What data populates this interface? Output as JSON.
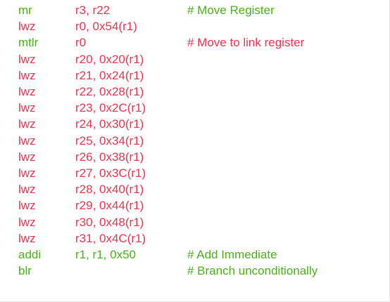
{
  "colors": {
    "green": "#4caf1e",
    "red": "#e8364f"
  },
  "lines": [
    {
      "op": "mr",
      "op_color": "green",
      "args": "r3, r22",
      "args_color": "red",
      "comment": "# Move Register",
      "comment_color": "green"
    },
    {
      "op": "lwz",
      "op_color": "red",
      "args": "r0, 0x54(r1)",
      "args_color": "red",
      "comment": "",
      "comment_color": "red"
    },
    {
      "op": "mtlr",
      "op_color": "green",
      "args": "r0",
      "args_color": "red",
      "comment": "# Move to link register",
      "comment_color": "red"
    },
    {
      "op": "lwz",
      "op_color": "red",
      "args": "r20, 0x20(r1)",
      "args_color": "red",
      "comment": "",
      "comment_color": "red"
    },
    {
      "op": "lwz",
      "op_color": "red",
      "args": "r21, 0x24(r1)",
      "args_color": "red",
      "comment": "",
      "comment_color": "red"
    },
    {
      "op": "lwz",
      "op_color": "red",
      "args": "r22, 0x28(r1)",
      "args_color": "red",
      "comment": "",
      "comment_color": "red"
    },
    {
      "op": "lwz",
      "op_color": "red",
      "args": "r23, 0x2C(r1)",
      "args_color": "red",
      "comment": "",
      "comment_color": "red"
    },
    {
      "op": "lwz",
      "op_color": "red",
      "args": "r24, 0x30(r1)",
      "args_color": "red",
      "comment": "",
      "comment_color": "red"
    },
    {
      "op": "lwz",
      "op_color": "red",
      "args": "r25, 0x34(r1)",
      "args_color": "red",
      "comment": "",
      "comment_color": "red"
    },
    {
      "op": "lwz",
      "op_color": "red",
      "args": "r26, 0x38(r1)",
      "args_color": "red",
      "comment": "",
      "comment_color": "red"
    },
    {
      "op": "lwz",
      "op_color": "red",
      "args": "r27, 0x3C(r1)",
      "args_color": "red",
      "comment": "",
      "comment_color": "red"
    },
    {
      "op": "lwz",
      "op_color": "red",
      "args": "r28, 0x40(r1)",
      "args_color": "red",
      "comment": "",
      "comment_color": "red"
    },
    {
      "op": "lwz",
      "op_color": "red",
      "args": "r29, 0x44(r1)",
      "args_color": "red",
      "comment": "",
      "comment_color": "red"
    },
    {
      "op": "lwz",
      "op_color": "red",
      "args": "r30, 0x48(r1)",
      "args_color": "red",
      "comment": "",
      "comment_color": "red"
    },
    {
      "op": "lwz",
      "op_color": "red",
      "args": "r31, 0x4C(r1)",
      "args_color": "red",
      "comment": "",
      "comment_color": "red"
    },
    {
      "op": "addi",
      "op_color": "green",
      "args": "r1, r1, 0x50",
      "args_color": "green",
      "comment": "# Add Immediate",
      "comment_color": "green"
    },
    {
      "op": "blr",
      "op_color": "green",
      "args": "",
      "args_color": "green",
      "comment": "# Branch unconditionally",
      "comment_color": "green"
    }
  ]
}
